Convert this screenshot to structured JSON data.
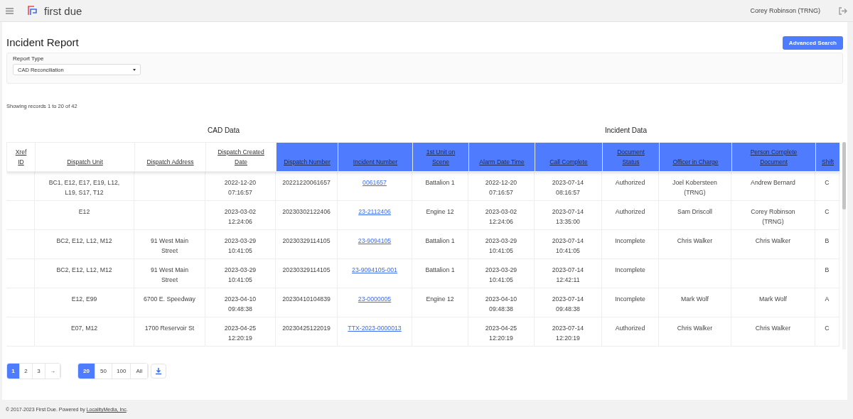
{
  "top_bar": {
    "brand": "first due",
    "user": "Corey Robinson (TRNG)"
  },
  "page": {
    "title": "Incident Report",
    "advanced_search": "Advanced Search"
  },
  "filter": {
    "label": "Report Type",
    "value": "CAD Reconciliation"
  },
  "records_text": "Showing records 1 to 20 of 42",
  "table": {
    "groups": [
      {
        "label": "CAD Data"
      },
      {
        "label": "Incident Data"
      }
    ],
    "columns": [
      {
        "label": "Xref ID",
        "highlight": false
      },
      {
        "label": "Dispatch Unit",
        "highlight": false
      },
      {
        "label": "Dispatch Address",
        "highlight": false
      },
      {
        "label": "Dispatch Created Date",
        "highlight": false
      },
      {
        "label": "Dispatch Number",
        "highlight": true
      },
      {
        "label": "Incident Number",
        "highlight": true,
        "kind": "link"
      },
      {
        "label": "1st Unit on Scene",
        "highlight": true
      },
      {
        "label": "Alarm Date Time",
        "highlight": true
      },
      {
        "label": "Call Complete",
        "highlight": true
      },
      {
        "label": "Document Status",
        "highlight": true
      },
      {
        "label": "Officer in Charge",
        "highlight": true
      },
      {
        "label": "Person Complete Document",
        "highlight": true
      },
      {
        "label": "Shift",
        "highlight": true
      }
    ],
    "rows": [
      [
        "",
        "BC1, E12, E17, E19, L12, L19, S17, T12",
        "",
        "2022-12-20 07:16:57",
        "20221220061657",
        "0061657",
        "Battalion 1",
        "2022-12-20 07:16:57",
        "2023-07-14 08:16:57",
        "Authorized",
        "Joel Kobersteen (TRNG)",
        "Andrew Bernard",
        "C"
      ],
      [
        "",
        "E12",
        "",
        "2023-03-02 12:24:06",
        "20230302122406",
        "23-2112406",
        "Engine 12",
        "2023-03-02 12:24:06",
        "2023-07-14 13:35:00",
        "Authorized",
        "Sam Driscoll",
        "Corey Robinson (TRNG)",
        "C"
      ],
      [
        "",
        "BC2, E12, L12, M12",
        "91 West Main Street",
        "2023-03-29 10:41:05",
        "20230329114105",
        "23-9094105",
        "Battalion 1",
        "2023-03-29 10:41:05",
        "2023-07-14 10:41:05",
        "Incomplete",
        "Chris Walker",
        "Chris Walker",
        "B"
      ],
      [
        "",
        "BC2, E12, L12, M12",
        "91 West Main Street",
        "2023-03-29 10:41:05",
        "20230329114105",
        "23-9094105-001",
        "Battalion 1",
        "2023-03-29 10:41:05",
        "2023-07-14 12:42:11",
        "Incomplete",
        "",
        "",
        "B"
      ],
      [
        "",
        "E12, E99",
        "6700 E. Speedway",
        "2023-04-10 09:48:38",
        "20230410104839",
        "23-0000005",
        "Engine 12",
        "2023-04-10 09:48:38",
        "2023-07-14 09:48:38",
        "Incomplete",
        "Mark Wolf",
        "Mark Wolf",
        "A"
      ],
      [
        "",
        "E07, M12",
        "1700 Reservoir St",
        "2023-04-25 12:20:19",
        "20230425122019",
        "TTX-2023-0000013",
        "",
        "2023-04-25 12:20:19",
        "2023-07-14 12:20:19",
        "Authorized",
        "Chris Walker",
        "Chris Walker",
        "C"
      ]
    ]
  },
  "pages": [
    {
      "label": "1",
      "selected": true
    },
    {
      "label": "2",
      "selected": false
    },
    {
      "label": "3",
      "selected": false
    },
    {
      "label": "→",
      "selected": false
    }
  ],
  "page_sizes": [
    {
      "label": "20",
      "selected": true
    },
    {
      "label": "50",
      "selected": false
    },
    {
      "label": "100",
      "selected": false
    },
    {
      "label": "All",
      "selected": false
    }
  ],
  "footer": {
    "text": "© 2017-2023 First Due. Powered by ",
    "link": "LocalityMedia, Inc",
    "end": "."
  }
}
